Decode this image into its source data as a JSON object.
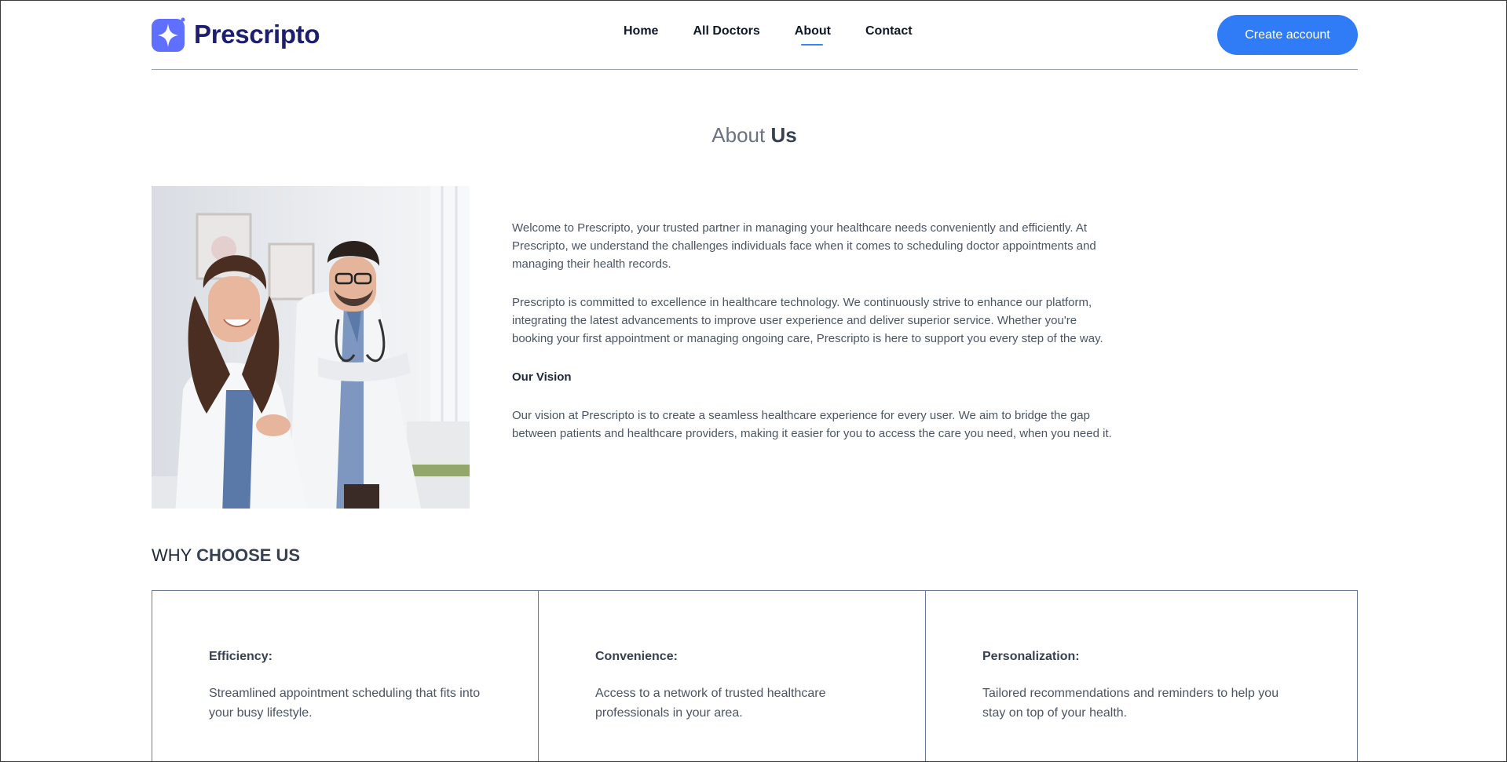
{
  "brand": {
    "name": "Prescripto",
    "accent_color": "#2f7cf6",
    "icon": "sparkle-logo-icon"
  },
  "nav": {
    "items": [
      {
        "label": "Home"
      },
      {
        "label": "All Doctors"
      },
      {
        "label": "About"
      },
      {
        "label": "Contact"
      }
    ],
    "active": "About",
    "cta_label": "Create account"
  },
  "about": {
    "title_light": "About",
    "title_bold": "Us",
    "image": "doctors-photo",
    "paragraph_1": "Welcome to Prescripto, your trusted partner in managing your healthcare needs conveniently and efficiently. At Prescripto, we understand the challenges individuals face when it comes to scheduling doctor appointments and managing their health records.",
    "paragraph_2": "Prescripto is committed to excellence in healthcare technology. We continuously strive to enhance our platform, integrating the latest advancements to improve user experience and deliver superior service. Whether you're booking your first appointment or managing ongoing care, Prescripto is here to support you every step of the way.",
    "vision_heading": "Our Vision",
    "vision_text": "Our vision at Prescripto is to create a seamless healthcare experience for every user. We aim to bridge the gap between patients and healthcare providers, making it easier for you to access the care you need, when you need it."
  },
  "why": {
    "title_light": "WHY",
    "title_bold": "CHOOSE US",
    "cards": [
      {
        "title": "Efficiency:",
        "text": "Streamlined appointment scheduling that fits into your busy lifestyle."
      },
      {
        "title": "Convenience:",
        "text": "Access to a network of trusted healthcare professionals in your area."
      },
      {
        "title": "Personalization:",
        "text": "Tailored recommendations and reminders to help you stay on top of your health."
      }
    ]
  }
}
